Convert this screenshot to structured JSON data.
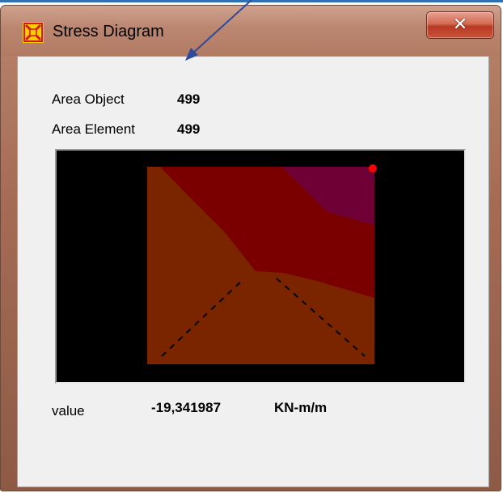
{
  "window": {
    "title": "Stress Diagram",
    "close_icon": "close-icon",
    "app_icon": "sap-app-icon"
  },
  "info": {
    "area_object_label": "Area Object",
    "area_object_value": "499",
    "area_element_label": "Area Element",
    "area_element_value": "499"
  },
  "result": {
    "value_label": "value",
    "value": "-19,341987",
    "unit": "KN-m/m"
  },
  "colors": {
    "contour_low": "#7a2400",
    "contour_mid": "#7a0000",
    "contour_high": "#6e0035",
    "selected_point": "#ff0000",
    "background": "#000000",
    "annotation_arrow": "#2f4a9a"
  }
}
